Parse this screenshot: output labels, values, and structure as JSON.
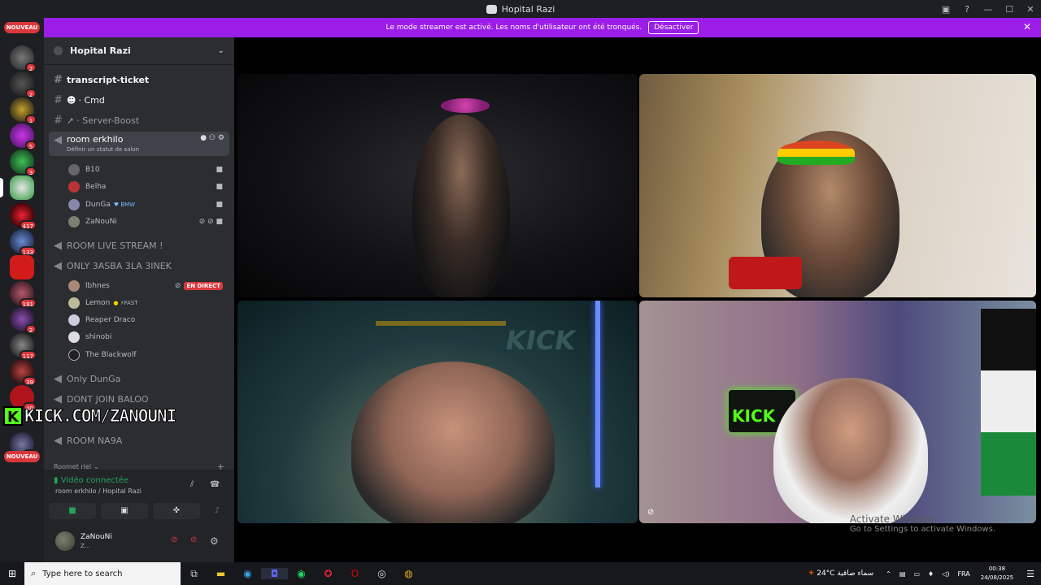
{
  "window": {
    "title": "Hopital Razi"
  },
  "banner": {
    "text": "Le mode streamer est activé. Les noms d'utilisateur ont été tronqués.",
    "button": "Désactiver"
  },
  "rail": {
    "nouveau_top": "NOUVEAU",
    "nouveau_bottom": "NOUVEAU",
    "badges": [
      "2",
      "2",
      "1",
      "5",
      "3",
      "417",
      "133",
      "191",
      "2",
      "117",
      "39",
      "40",
      "13"
    ]
  },
  "server": {
    "name": "Hopital Razi"
  },
  "channels": {
    "c1": "transcript-ticket",
    "c2": "· Cmd",
    "c3": "· Server-Boost",
    "active": "room erkhilo",
    "active_status": "Définir un statut de salon",
    "live_stream": "ROOM LIVE STREAM !",
    "only3asba": "ONLY 3ASBA 3LA 3INEK",
    "only_dunga": "Only DunGa",
    "dont_join": "DONT JOIN BALOO",
    "na9a": "ROOM NA9A",
    "roomet": "Roomet riel"
  },
  "users_room": [
    "B10",
    "Belha",
    "DunGa",
    "ZaNouNi"
  ],
  "dunga_tag": "BMW",
  "users_3asba": [
    "lbhnes",
    "Lemon",
    "Reaper Draco",
    "shinobi",
    "The Blackwolf"
  ],
  "live_badge": "EN DIRECT",
  "lemon_tag": "⚡FAST",
  "kick": {
    "letter": "K",
    "text": "KICK.COM/ZANOUNI"
  },
  "voice": {
    "status": "Vidéo connectée",
    "location": "room erkhilo / Hopital Razi"
  },
  "user_panel": {
    "name": "ZaNouNi",
    "sub": "Z..."
  },
  "watermark": {
    "line1": "Activate Windows",
    "line2": "Go to Settings to activate Windows."
  },
  "taskbar": {
    "search_placeholder": "Type here to search",
    "weather_temp": "24°C",
    "weather_desc": "سماء صافية",
    "lang": "FRA",
    "time": "00:38",
    "date": "24/08/2025"
  },
  "video_text": {
    "kick_sign": "KICK",
    "kick_wall": "KICK"
  },
  "colors": {
    "accent": "#9b1de8",
    "live_red": "#da373c",
    "connected": "#23a55a",
    "kick_green": "#53fc18"
  }
}
